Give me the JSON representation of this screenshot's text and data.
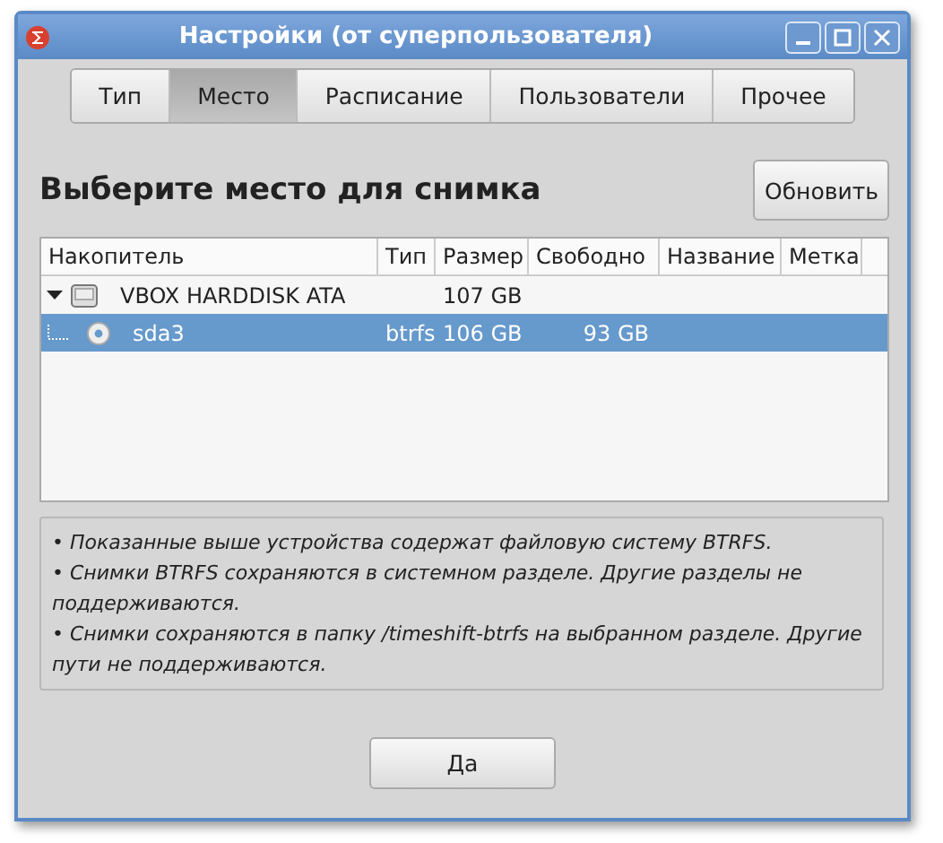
{
  "window": {
    "title": "Настройки (от суперпользователя)"
  },
  "tabs": [
    {
      "label": "Тип",
      "selected": false
    },
    {
      "label": "Место",
      "selected": true
    },
    {
      "label": "Расписание",
      "selected": false
    },
    {
      "label": "Пользователи",
      "selected": false
    },
    {
      "label": "Прочее",
      "selected": false
    }
  ],
  "heading": "Выберите место для снимка",
  "refresh_button": "Обновить",
  "table": {
    "columns": [
      "Накопитель",
      "Тип",
      "Размер",
      "Свободно",
      "Название",
      "Метка"
    ],
    "rows": [
      {
        "device": "VBOX HARDDISK ATA",
        "type": "",
        "size": "107 GB",
        "free": "",
        "expanded": true,
        "selected": false,
        "children": [
          {
            "device": "sda3",
            "type": "btrfs",
            "size": "106 GB",
            "free": "93 GB",
            "selected": true
          }
        ]
      }
    ]
  },
  "notes": [
    "• Показанные выше устройства содержат файловую систему BTRFS.",
    "• Снимки BTRFS сохраняются в системном разделе. Другие разделы не поддерживаются.",
    "• Снимки сохраняются в папку /timeshift-btrfs на выбранном разделе. Другие пути не поддерживаются."
  ],
  "ok_button": "Да"
}
